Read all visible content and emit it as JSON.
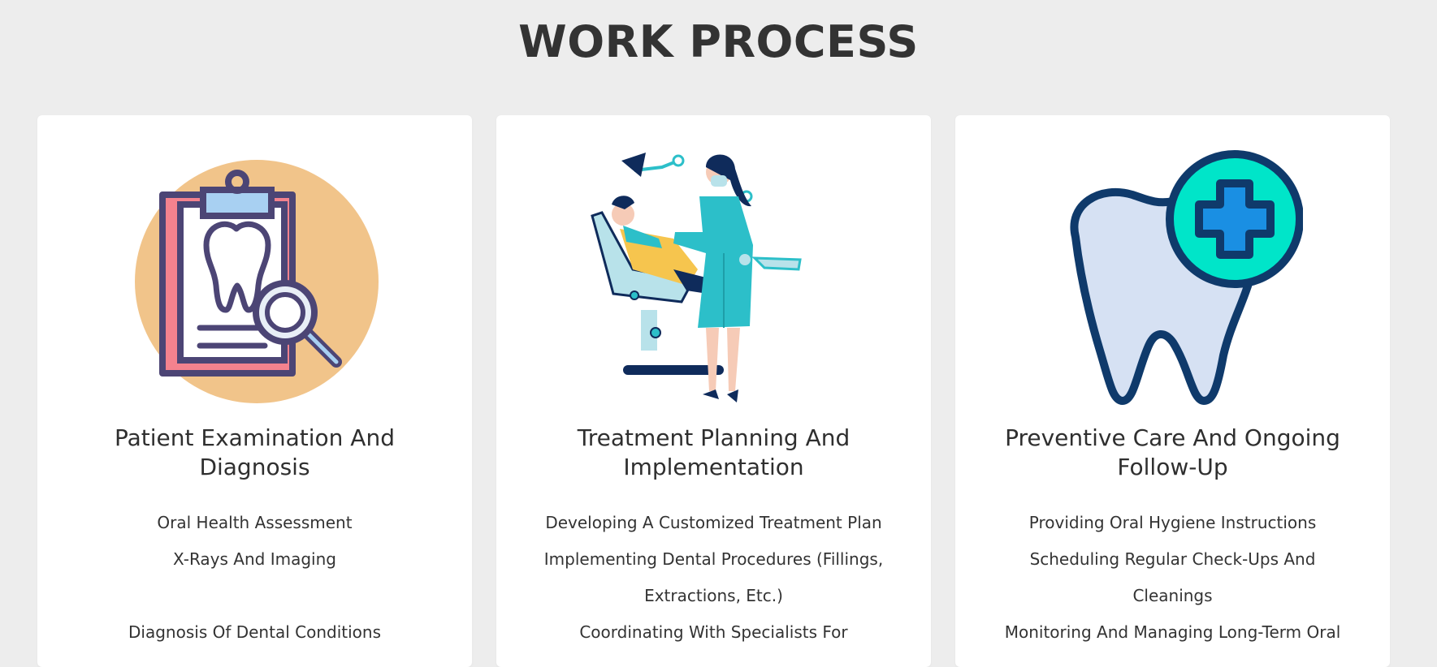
{
  "page": {
    "title": "WORK PROCESS"
  },
  "colors": {
    "background": "#ededed",
    "card": "#ffffff",
    "text": "#333333",
    "teal": "#2cbfc9",
    "navy": "#0f2b5b",
    "peach": "#f1c48a"
  },
  "cards": [
    {
      "icon": "clipboard-tooth-magnifier-icon",
      "title_line1": "Patient Examination And",
      "title_line2": "Diagnosis",
      "items": [
        "Oral Health Assessment",
        "X-Rays And Imaging",
        "Diagnosis Of Dental Conditions"
      ]
    },
    {
      "icon": "dentist-with-patient-icon",
      "title_line1": "Treatment Planning And",
      "title_line2": "Implementation",
      "items": [
        "Developing A Customized Treatment Plan",
        "Implementing Dental Procedures (Fillings,",
        "Extractions, Etc.)",
        "Coordinating With Specialists For"
      ]
    },
    {
      "icon": "tooth-with-medical-cross-icon",
      "title_line1": "Preventive Care And Ongoing",
      "title_line2": "Follow-Up",
      "items": [
        "Providing Oral Hygiene Instructions",
        "Scheduling Regular Check-Ups And",
        "Cleanings",
        "Monitoring And Managing Long-Term Oral"
      ]
    }
  ]
}
